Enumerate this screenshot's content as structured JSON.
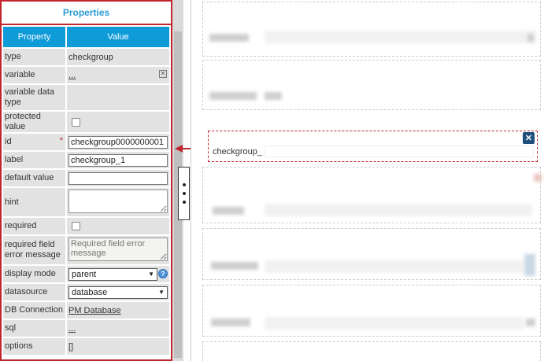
{
  "panel": {
    "title": "Properties",
    "columns": {
      "property": "Property",
      "value": "Value"
    },
    "rows": {
      "type": {
        "label": "type",
        "value": "checkgroup"
      },
      "variable": {
        "label": "variable",
        "value": "..."
      },
      "variable_data_type": {
        "label": "variable data type"
      },
      "protected_value": {
        "label": "protected value"
      },
      "id": {
        "label": "id",
        "required_marker": "*",
        "value": "checkgroup0000000001"
      },
      "label": {
        "label": "label",
        "value": "checkgroup_1"
      },
      "default_value": {
        "label": "default value",
        "value": ""
      },
      "hint": {
        "label": "hint",
        "value": ""
      },
      "required": {
        "label": "required"
      },
      "required_error": {
        "label": "required field error message",
        "placeholder": "Required field error message"
      },
      "display_mode": {
        "label": "display mode",
        "value": "parent"
      },
      "datasource": {
        "label": "datasource",
        "value": "database"
      },
      "db_connection": {
        "label": "DB Connection",
        "value": "PM Database"
      },
      "sql": {
        "label": "sql",
        "value": "..."
      },
      "options": {
        "label": "options",
        "value": "[]"
      }
    }
  },
  "canvas": {
    "selected_field": {
      "label": "checkgroup_"
    }
  },
  "icons": {
    "clear": "clear-icon",
    "help": "help-icon",
    "close": "close-icon",
    "dropdown": "chevron-down-icon"
  },
  "colors": {
    "panel_border": "#c0262d",
    "header_blue": "#0f9ad8",
    "title_blue": "#2a9bd3",
    "close_button": "#1e4f7a"
  }
}
